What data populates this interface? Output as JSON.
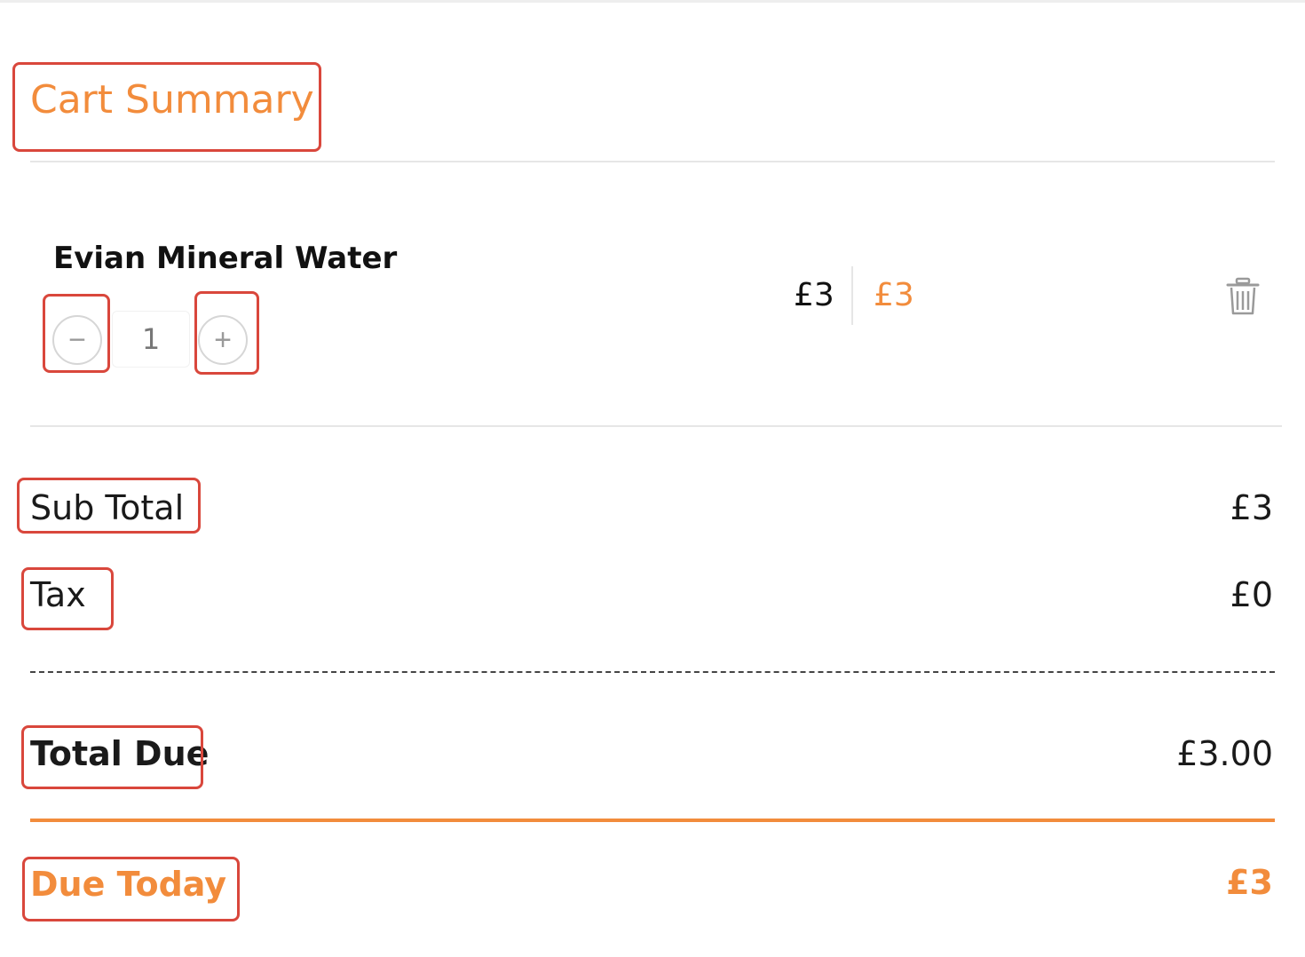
{
  "cart": {
    "title": "Cart Summary",
    "item": {
      "name": "Evian Mineral Water",
      "quantity": "1",
      "decrease_symbol": "−",
      "increase_symbol": "+",
      "price": "£3",
      "line_total": "£3",
      "delete_icon": "trash-icon"
    },
    "summary": {
      "subtotal_label": "Sub Total",
      "subtotal_value": "£3",
      "tax_label": "Tax",
      "tax_value": "£0",
      "total_due_label": "Total Due",
      "total_due_value": "£3.00",
      "due_today_label": "Due Today",
      "due_today_value": "£3"
    }
  },
  "colors": {
    "accent": "#f28c3c",
    "highlight_box": "#d9473c",
    "text": "#1a1a1a",
    "divider": "#e6e6e6"
  }
}
